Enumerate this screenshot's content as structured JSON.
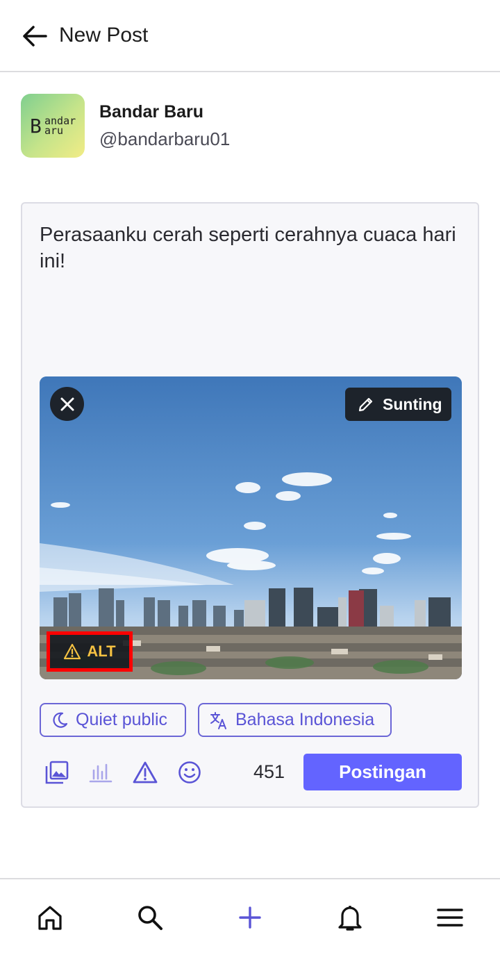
{
  "header": {
    "title": "New Post",
    "back_icon": "arrow-left-icon"
  },
  "account": {
    "display_name": "Bandar Baru",
    "handle": "@bandarbaru01",
    "avatar_text_big": "B",
    "avatar_text_line1": "andar",
    "avatar_text_line2": "aru"
  },
  "composer": {
    "text": "Perasaanku cerah seperti cerahnya cuaca hari ini!",
    "media": {
      "remove_icon": "close-icon",
      "edit_label": "Sunting",
      "edit_icon": "pencil-icon",
      "alt_label": "ALT",
      "alt_icon": "warning-icon"
    },
    "visibility_label": "Quiet public",
    "visibility_icon": "moon-icon",
    "language_label": "Bahasa Indonesia",
    "language_icon": "translate-icon",
    "toolbar": {
      "icons": [
        "image-icon",
        "poll-icon",
        "content-warning-icon",
        "emoji-icon"
      ],
      "char_count": "451",
      "post_label": "Postingan"
    }
  },
  "bottom_nav": {
    "items": [
      "home-icon",
      "search-icon",
      "compose-icon",
      "notifications-icon",
      "menu-icon"
    ]
  },
  "colors": {
    "accent": "#6364ff",
    "chip_text": "#5a54d6",
    "alt_warning": "#f5c242",
    "highlight_border": "#ff0000"
  }
}
